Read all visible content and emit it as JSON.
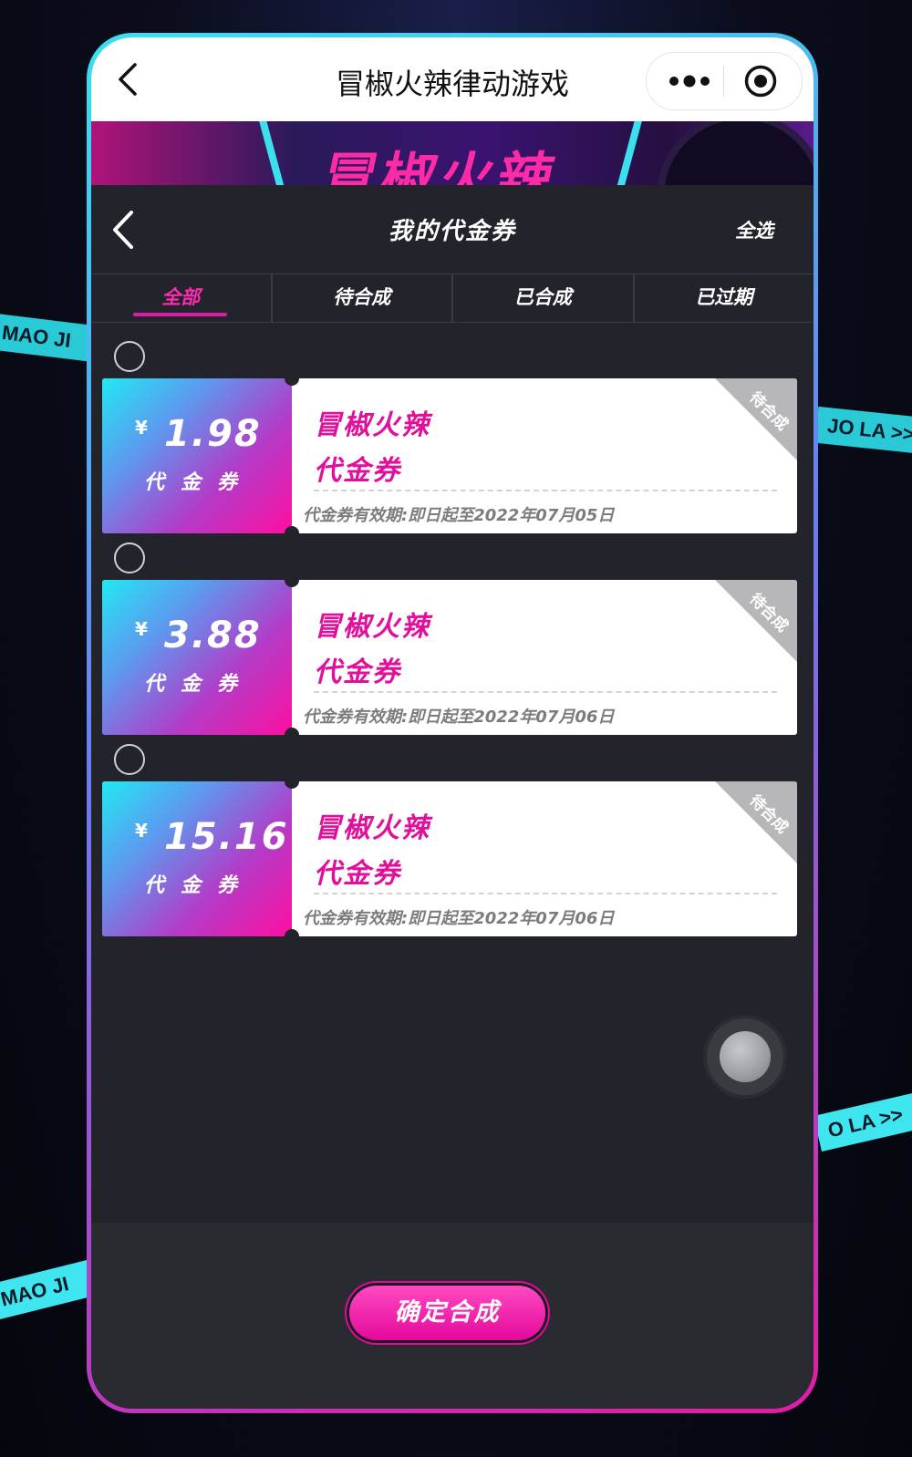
{
  "background_ribbons": [
    "MAO JI",
    "JO LA >>",
    "O LA >>",
    "MAO JI"
  ],
  "wechat_bar": {
    "title": "冒椒火辣律动游戏",
    "more_icon": "more-dots-icon",
    "close_icon": "target-circle-icon"
  },
  "banner": {
    "text": "冒椒火辣"
  },
  "header": {
    "title": "我的代金券",
    "select_all": "全选"
  },
  "tabs": [
    {
      "label": "全部",
      "active": true
    },
    {
      "label": "待合成",
      "active": false
    },
    {
      "label": "已合成",
      "active": false
    },
    {
      "label": "已过期",
      "active": false
    }
  ],
  "vouchers": [
    {
      "currency": "¥",
      "amount": "1.98",
      "unit": "代金券",
      "title": "冒椒火辣",
      "subtitle": "代金券",
      "validity": "代金券有效期:即日起至2022年07月05日",
      "status": "待合成"
    },
    {
      "currency": "¥",
      "amount": "3.88",
      "unit": "代金券",
      "title": "冒椒火辣",
      "subtitle": "代金券",
      "validity": "代金券有效期:即日起至2022年07月06日",
      "status": "待合成"
    },
    {
      "currency": "¥",
      "amount": "15.16",
      "unit": "代金券",
      "title": "冒椒火辣",
      "subtitle": "代金券",
      "validity": "代金券有效期:即日起至2022年07月06日",
      "status": "待合成"
    }
  ],
  "confirm_button": "确定合成",
  "colors": {
    "accent": "#e4099c",
    "cyan": "#29c9d6",
    "panel": "#23242b"
  }
}
